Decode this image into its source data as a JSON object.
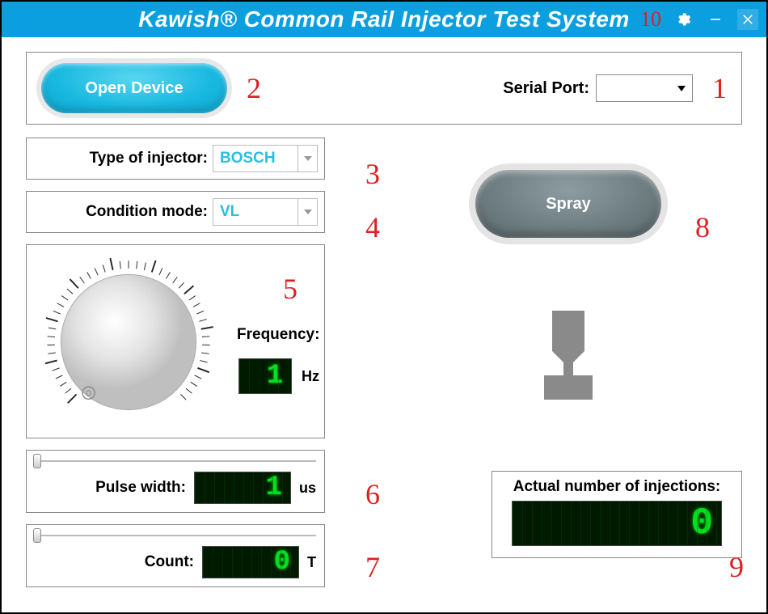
{
  "title": "Kawish® Common Rail Injector Test System",
  "annotations": {
    "a1": "1",
    "a2": "2",
    "a3": "3",
    "a4": "4",
    "a5": "5",
    "a6": "6",
    "a7": "7",
    "a8": "8",
    "a9": "9",
    "a10": "10"
  },
  "top": {
    "open_label": "Open Device",
    "serial_label": "Serial Port:",
    "serial_value": ""
  },
  "injector_type": {
    "label": "Type of injector:",
    "value": "BOSCH"
  },
  "condition_mode": {
    "label": "Condition mode:",
    "value": "VL"
  },
  "frequency": {
    "label": "Frequency:",
    "value": "1",
    "unit": "Hz"
  },
  "pulse_width": {
    "label": "Pulse width:",
    "value": "1",
    "unit": "us"
  },
  "count": {
    "label": "Count:",
    "value": "0",
    "unit": "T"
  },
  "spray": {
    "label": "Spray"
  },
  "actual": {
    "label": "Actual number of injections:",
    "value": "0"
  }
}
